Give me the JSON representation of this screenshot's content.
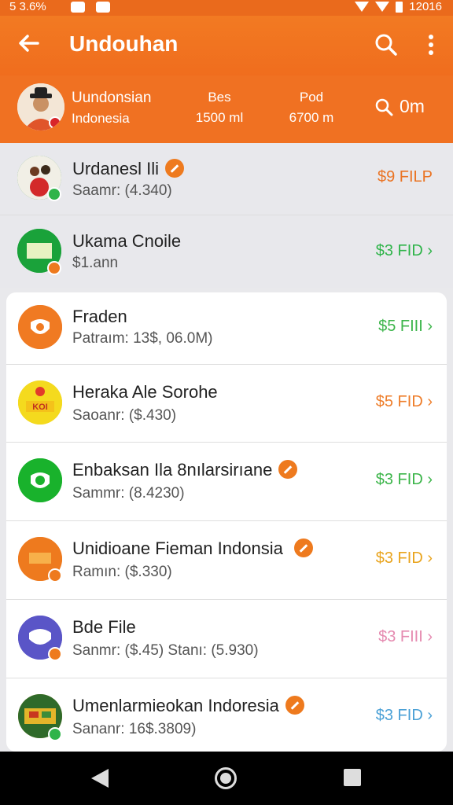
{
  "status_bar": {
    "time": "5 3.6%",
    "clock": "12016"
  },
  "app_bar": {
    "title": "Undouhan"
  },
  "profile": {
    "name": "Uundonsian",
    "country": "Indonesia",
    "stats": [
      {
        "label": "Bes",
        "value": "1500 ml"
      },
      {
        "label": "Pod",
        "value": "6700 m"
      }
    ],
    "quick_value": "0m"
  },
  "items": [
    {
      "name": "Urdanesl Ili",
      "sub": "Saamr: (4.340)",
      "price": "$9 FILP",
      "price_color": "#ea7424",
      "icon_color": "#2f8b3a",
      "verified": true
    },
    {
      "name": "Ukama Cnoile",
      "sub": "$1.ann",
      "price": "$3 FID",
      "price_color": "#2fb44a",
      "icon_color": "#1aa23a",
      "verified": false
    },
    {
      "name": "Fraden",
      "sub": "Patraım: 13$, 06.0M)",
      "price": "$5 FIII",
      "price_color": "#3cb54a",
      "icon_color": "#f07a22",
      "verified": false
    },
    {
      "name": "Heraka Ale Sorohe",
      "sub": "Saoanr: ($.430)",
      "price": "$5 FID",
      "price_color": "#ee7d2a",
      "icon_color": "#f2d41c",
      "verified": false
    },
    {
      "name": "Enbaksan Ila 8nılarsirıane",
      "sub": "Sammr: (8.4230)",
      "price": "$3 FID",
      "price_color": "#3cb54a",
      "icon_color": "#19b22c",
      "verified": true
    },
    {
      "name": "Unidioane Fieman Indonsia",
      "sub": "Ramın: ($.330)",
      "price": "$3 FID",
      "price_color": "#e9a41d",
      "icon_color": "#ee7a1e",
      "verified": true
    },
    {
      "name": "Bde File",
      "sub": "Sanmr: ($.45)  Stanı: (5.930)",
      "price": "$3 FIII",
      "price_color": "#e58ab0",
      "icon_color": "#5a55c7",
      "verified": false
    },
    {
      "name": "Umenlarmieokan Indoresia",
      "sub": "Sananr: 16$.3809)",
      "price": "$3 FID",
      "price_color": "#4aa0d6",
      "icon_color": "#d2a222",
      "verified": true
    }
  ]
}
